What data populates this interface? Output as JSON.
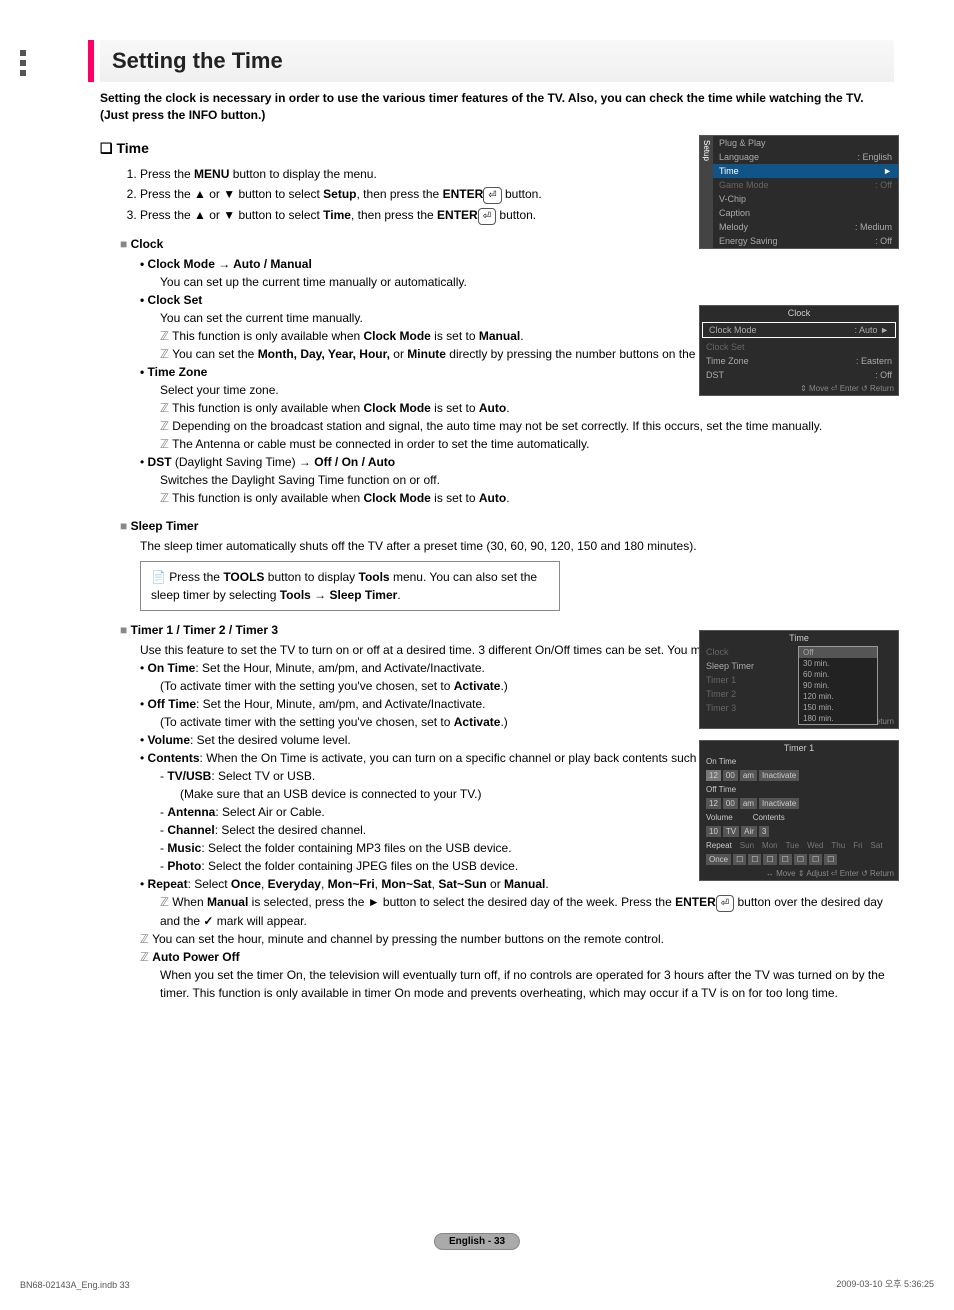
{
  "page": {
    "title": "Setting the Time",
    "intro": "Setting the clock is necessary in order to use the various timer features of the TV. Also, you can check the time while watching the TV. (Just press the INFO button.)",
    "footer_page": "English - 33",
    "footer_left": "BN68-02143A_Eng.indb   33",
    "footer_right": "2009-03-10   오후 5:36:25"
  },
  "section_time": {
    "heading": "Time",
    "steps": {
      "s1a": "Press the ",
      "s1b": "MENU",
      "s1c": " button to display the menu.",
      "s2a": "Press the ▲ or ▼ button to select ",
      "s2b": "Setup",
      "s2c": ", then press the ",
      "s2d": "ENTER",
      "s2e": " button.",
      "s3a": "Press the ▲ or ▼ button to select ",
      "s3b": "Time",
      "s3c": ", then press the ",
      "s3d": "ENTER",
      "s3e": " button."
    }
  },
  "clock": {
    "heading": "Clock",
    "mode_line": "Clock Mode → Auto / Manual",
    "mode_desc": "You can set up the current time manually or automatically.",
    "set_line": "Clock Set",
    "set_desc": "You can set the current time manually.",
    "note1_a": "This function is only available when ",
    "note1_b": "Clock Mode",
    "note1_c": " is set to ",
    "note1_d": "Manual",
    "note1_e": ".",
    "note2_a": "You can set the ",
    "note2_b": "Month, Day, Year, Hour,",
    "note2_c": " or ",
    "note2_d": "Minute",
    "note2_e": " directly by pressing the number buttons on the remote control.",
    "tz_line": "Time Zone",
    "tz_desc": "Select your time zone.",
    "note3_a": "This function is only available when ",
    "note3_b": "Clock Mode",
    "note3_c": " is set to ",
    "note3_d": "Auto",
    "note3_e": ".",
    "note4": "Depending on the broadcast station and signal, the auto time may not be set correctly. If this occurs, set the time manually.",
    "note5": "The Antenna or cable must be connected in order to set the time automatically.",
    "dst_line_a": "DST",
    "dst_line_b": " (Daylight Saving Time) → ",
    "dst_line_c": "Off / On / Auto",
    "dst_desc": "Switches the Daylight Saving Time function on or off.",
    "note6_a": "This function is only available when ",
    "note6_b": "Clock Mode",
    "note6_c": " is set to ",
    "note6_d": "Auto",
    "note6_e": "."
  },
  "sleep": {
    "heading": "Sleep Timer",
    "desc": "The sleep timer automatically shuts off the TV after a preset time (30, 60, 90, 120, 150 and 180 minutes).",
    "tip_a": "Press the ",
    "tip_b": "TOOLS",
    "tip_c": " button to display ",
    "tip_d": "Tools",
    "tip_e": " menu. You can also set the sleep timer by selecting ",
    "tip_f": "Tools → Sleep Timer",
    "tip_g": "."
  },
  "timers": {
    "heading": "Timer 1 / Timer 2 / Timer 3",
    "desc": "Use this feature to set the TV to turn on or off at a desired time. 3 different On/Off times can be set. You must set the clock first.",
    "on_a": "On Time",
    "on_b": ": Set the Hour, Minute, am/pm, and Activate/Inactivate.",
    "on_c": "(To activate timer with the setting you've chosen, set to ",
    "on_d": "Activate",
    "on_e": ".)",
    "off_a": "Off Time",
    "off_b": ": Set the Hour, Minute, am/pm, and Activate/Inactivate.",
    "off_c": "(To activate timer with the setting you've chosen, set to ",
    "off_d": "Activate",
    "off_e": ".)",
    "vol_a": "Volume",
    "vol_b": ": Set the desired volume level.",
    "cont_a": "Contents",
    "cont_b": ": When the On Time is activate, you can turn on a specific channel or play back contents such as photo or audio files.",
    "tv_a": "TV/USB",
    "tv_b": ": Select TV or USB.",
    "tv_c": "(Make sure that an USB device is connected to your TV.)",
    "ant_a": "Antenna",
    "ant_b": ": Select Air or Cable.",
    "ch_a": "Channel",
    "ch_b": ": Select the desired channel.",
    "mus_a": "Music",
    "mus_b": ": Select the folder containing MP3 files on the USB device.",
    "ph_a": "Photo",
    "ph_b": ": Select the folder containing JPEG files on the USB device.",
    "rep_a": "Repeat",
    "rep_b": ": Select ",
    "rep_c": "Once",
    "rep_d": "Everyday",
    "rep_e": "Mon~Fri",
    "rep_f": "Mon~Sat",
    "rep_g": "Sat~Sun",
    "rep_h": "Manual",
    "rep_note_a": "When ",
    "rep_note_b": "Manual",
    "rep_note_c": " is selected, press the ► button to select the desired day of the week. Press the ",
    "rep_note_d": "ENTER",
    "rep_note_e": " button over the desired day and the ",
    "rep_note_f": " ✓ ",
    "rep_note_g": " mark will appear.",
    "note_number": "You can set the hour, minute and channel by pressing the number buttons on the remote control.",
    "apo_heading": "Auto Power Off",
    "apo_desc": "When you set the timer On, the television will eventually turn off, if no controls are operated for 3 hours after the TV was turned on by the timer. This function is only available in timer On mode and prevents overheating, which may occur if a TV is on for too long time."
  },
  "osd1": {
    "side": "Setup",
    "r1": {
      "k": "Plug & Play",
      "v": ""
    },
    "r2": {
      "k": "Language",
      "v": ": English"
    },
    "hl": {
      "k": "Time",
      "v": "►"
    },
    "r3": {
      "k": "Game Mode",
      "v": ": Off"
    },
    "r4": {
      "k": "V-Chip",
      "v": ""
    },
    "r5": {
      "k": "Caption",
      "v": ""
    },
    "r6": {
      "k": "Melody",
      "v": ": Medium"
    },
    "r7": {
      "k": "Energy Saving",
      "v": ": Off"
    }
  },
  "osd2": {
    "title": "Clock",
    "r1": {
      "k": "Clock Mode",
      "v": ": Auto"
    },
    "r2": {
      "k": "Clock Set",
      "v": ""
    },
    "r3": {
      "k": "Time Zone",
      "v": ": Eastern"
    },
    "r4": {
      "k": "DST",
      "v": ": Off"
    },
    "footer": "⇕ Move     ⏎ Enter     ↺ Return"
  },
  "osd3": {
    "title": "Time",
    "rows": [
      "Clock",
      "Sleep Timer",
      "Timer 1",
      "Timer 2",
      "Timer 3"
    ],
    "popup": [
      "Off",
      "30 min.",
      "60 min.",
      "90 min.",
      "120 min.",
      "150 min.",
      "180 min."
    ],
    "footer": "⇕ Move     ⏎ Enter     ↺ Return"
  },
  "osd4": {
    "title": "Timer 1",
    "on": "On Time",
    "on_vals": [
      "12",
      "00",
      "am",
      "Inactivate"
    ],
    "off": "Off Time",
    "off_vals": [
      "12",
      "00",
      "am",
      "Inactivate"
    ],
    "vol": "Volume",
    "vol_v": "10",
    "contents": "Contents",
    "cont_vals": [
      "TV",
      "Air",
      "3"
    ],
    "repeat": "Repeat",
    "repeat_days": [
      "Sun",
      "Mon",
      "Tue",
      "Wed",
      "Thu",
      "Fri",
      "Sat"
    ],
    "once": "Once",
    "footer": "↔ Move   ⇕ Adjust   ⏎ Enter   ↺ Return"
  }
}
